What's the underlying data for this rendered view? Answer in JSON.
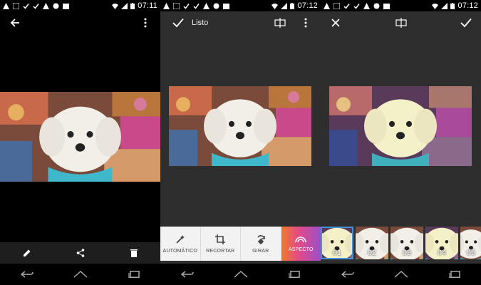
{
  "screens": [
    {
      "status": {
        "time": "07:11"
      },
      "icons": {
        "back": "arrow-left-icon",
        "menu": "more-vert-icon"
      },
      "bottom_actions": [
        "edit-icon",
        "share-icon",
        "delete-icon"
      ]
    },
    {
      "status": {
        "time": "07:12"
      },
      "header": {
        "done_label": "Listo"
      },
      "tools": [
        {
          "label": "AUTOMÁTICO",
          "icon": "magic-wand-icon"
        },
        {
          "label": "RECORTAR",
          "icon": "crop-icon"
        },
        {
          "label": "GIRAR",
          "icon": "rotate-icon"
        },
        {
          "label": "ASPECTO",
          "icon": "rainbow-icon"
        }
      ]
    },
    {
      "status": {
        "time": "07:12"
      },
      "filters": [
        {
          "label": "01",
          "selected": true
        },
        {
          "label": "02",
          "selected": false
        },
        {
          "label": "03",
          "selected": false
        },
        {
          "label": "04",
          "selected": false
        },
        {
          "label": "05",
          "selected": false
        }
      ]
    }
  ],
  "colors": {
    "accent": "#4a90d9",
    "editor_bg": "#2e2e2e",
    "tool_bg": "#f2f2f2"
  }
}
